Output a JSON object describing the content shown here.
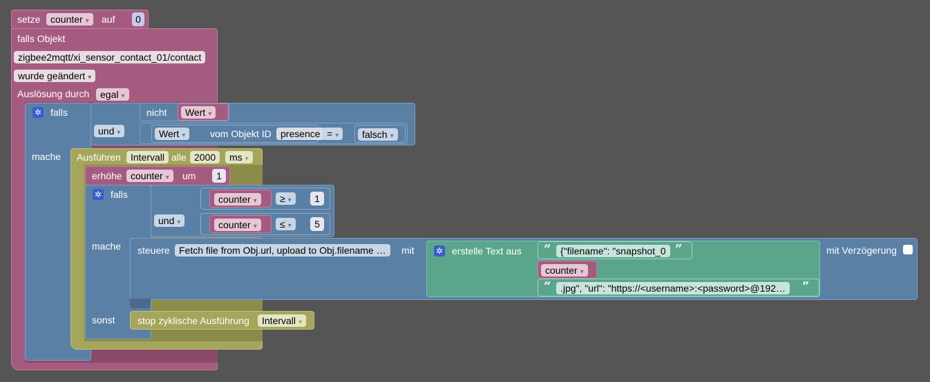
{
  "setze": {
    "label": "setze",
    "var": "counter",
    "auf": "auf",
    "value": "0"
  },
  "trigger": {
    "falls_objekt": "falls Objekt",
    "object_id": "zigbee2mqtt/xi_sensor_contact_01/contact",
    "changed": "wurde geändert",
    "ausloesung": "Auslösung durch",
    "ausloesung_value": "egal"
  },
  "outer_if": {
    "falls": "falls",
    "und": "und",
    "nicht": "nicht",
    "wert": "Wert",
    "wert2": "Wert",
    "vom_objekt": "vom Objekt ID",
    "object": "presence",
    "op": "=",
    "falsch": "falsch",
    "mache": "mache"
  },
  "interval": {
    "ausfuehren": "Ausführen",
    "name": "Intervall",
    "alle": "alle",
    "ms_value": "2000",
    "unit": "ms"
  },
  "increment": {
    "label": "erhöhe",
    "var": "counter",
    "um": "um",
    "value": "1"
  },
  "inner_if": {
    "falls": "falls",
    "und": "und",
    "var1": "counter",
    "op1": "≥",
    "val1": "1",
    "var2": "counter",
    "op2": "≤",
    "val2": "5",
    "mache": "mache",
    "sonst": "sonst"
  },
  "steuere": {
    "label": "steuere",
    "target": "Fetch file from Obj.url, upload to Obj.filename …",
    "mit": "mit",
    "erstelle": "erstelle Text aus",
    "text1": "{\"filename\": \"snapshot_0",
    "var": "counter",
    "text2": ".jpg\", \"url\": \"https://<username>:<password>@192…",
    "delay": "mit Verzögerung"
  },
  "stop": {
    "label": "stop zyklische Ausführung",
    "name": "Intervall"
  }
}
